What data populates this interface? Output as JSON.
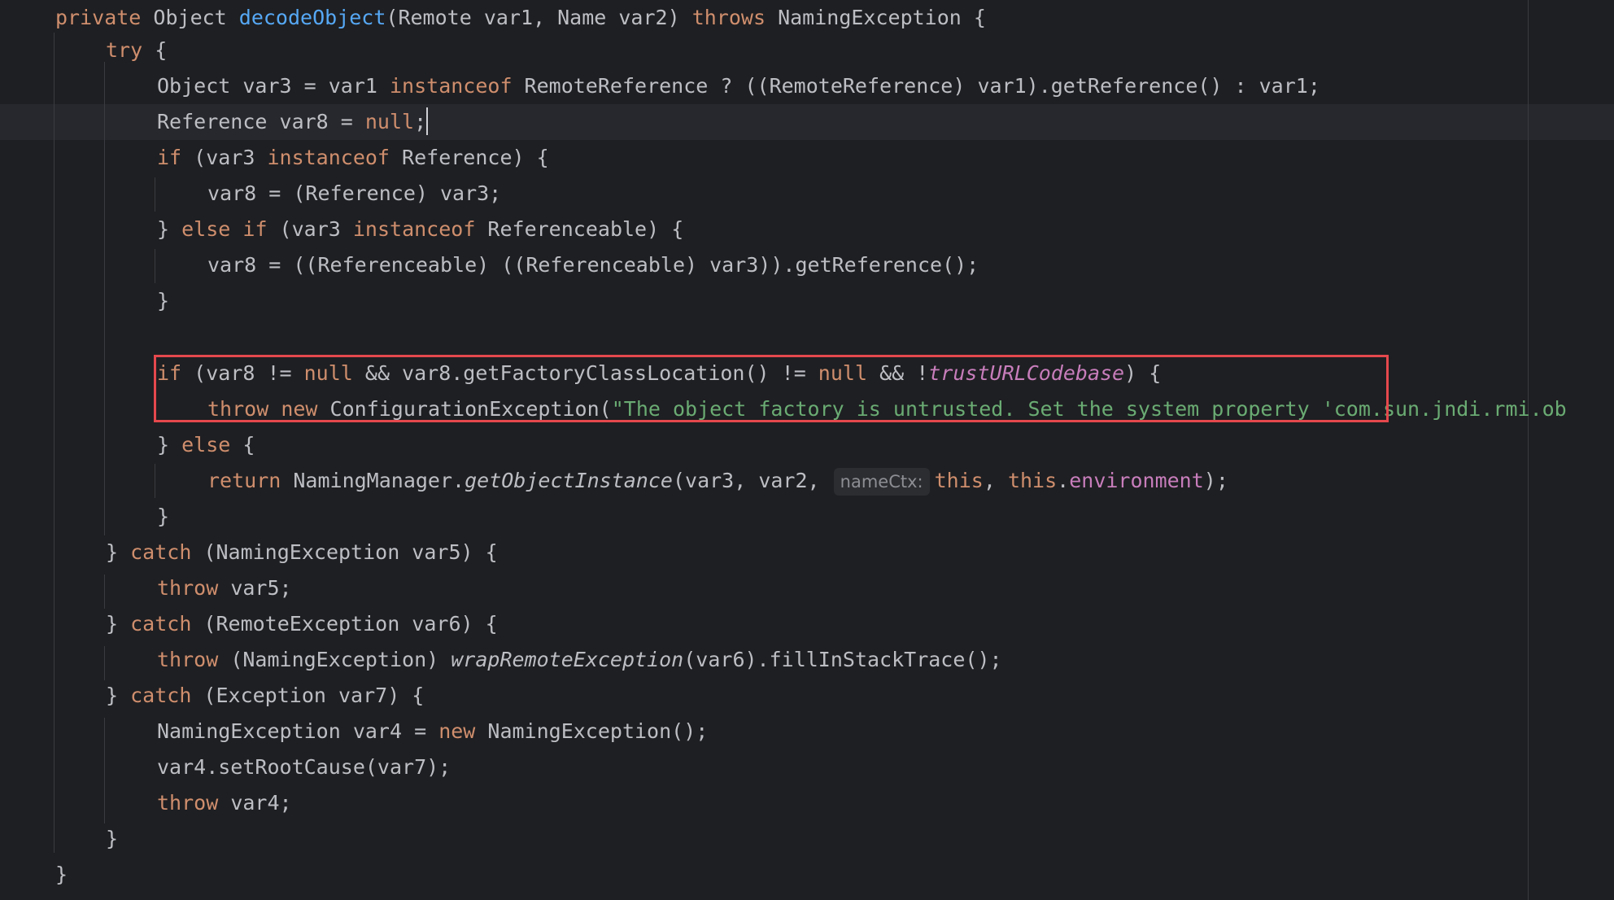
{
  "editor": {
    "language": "java",
    "colors": {
      "background": "#1e1f22",
      "text": "#bcbec4",
      "keyword": "#cf8e6d",
      "method_declaration": "#56a8f5",
      "string": "#6aab73",
      "field": "#c77dbb",
      "highlight_box": "#e5484d"
    },
    "lines": [
      [
        "private",
        " Object ",
        "decodeObject",
        "(Remote var1, Name var2) ",
        "throws",
        " NamingException {"
      ],
      [
        "try",
        " {"
      ],
      [
        "Object var3 = var1 ",
        "instanceof",
        " RemoteReference ? ((RemoteReference) var1).getReference() : var1;"
      ],
      [
        "Reference var8 = ",
        "null",
        ";"
      ],
      [
        "if",
        " (var3 ",
        "instanceof",
        " Reference) {"
      ],
      [
        "var8 = (Reference) var3;"
      ],
      [
        "} ",
        "else",
        " ",
        "if",
        " (var3 ",
        "instanceof",
        " Referenceable) {"
      ],
      [
        "var8 = ((Referenceable) ((Referenceable) var3)).getReference();"
      ],
      [
        "}"
      ],
      [
        "if",
        " (var8 != ",
        "null",
        " && var8.getFactoryClassLocation() != ",
        "null",
        " && !",
        "trustURLCodebase",
        ") {"
      ],
      [
        "throw",
        " ",
        "new",
        " ConfigurationException(",
        "\"The object factory is untrusted. Set the system property 'com.sun.jndi.rmi.ob"
      ],
      [
        "} ",
        "else",
        " {"
      ],
      [
        "return",
        " NamingManager.",
        "getObjectInstance",
        "(var3, var2, ",
        "nameCtx:",
        "this",
        ", ",
        "this",
        ".",
        "environment",
        ");"
      ],
      [
        "}"
      ],
      [
        "} ",
        "catch",
        " (NamingException var5) {"
      ],
      [
        "throw",
        " var5;"
      ],
      [
        "} ",
        "catch",
        " (RemoteException var6) {"
      ],
      [
        "throw",
        " (NamingException) ",
        "wrapRemoteException",
        "(var6).fillInStackTrace();"
      ],
      [
        "} ",
        "catch",
        " (Exception var7) {"
      ],
      [
        "NamingException var4 = ",
        "new",
        " NamingException();"
      ],
      [
        "var4.setRootCause(var7);"
      ],
      [
        "throw",
        " var4;"
      ],
      [
        "}"
      ],
      [
        "}"
      ]
    ]
  }
}
